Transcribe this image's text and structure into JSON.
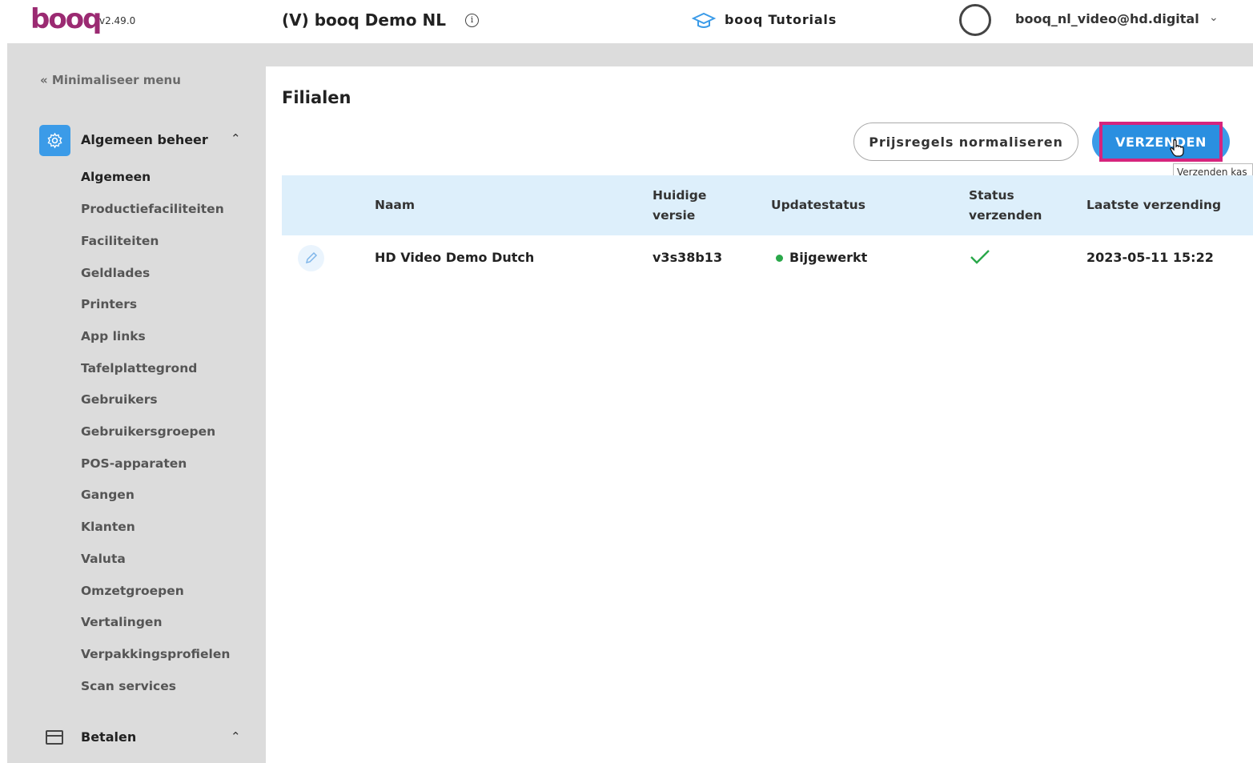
{
  "header": {
    "logo": "booq",
    "version": "v2.49.0",
    "venue": "(V) booq Demo NL",
    "tutorials": "booq Tutorials",
    "user_email": "booq_nl_video@hd.digital"
  },
  "sidebar": {
    "minimize_label": "Minimaliseer menu",
    "section_title": "Algemeen beheer",
    "items": [
      {
        "label": "Algemeen"
      },
      {
        "label": "Productiefaciliteiten"
      },
      {
        "label": "Faciliteiten"
      },
      {
        "label": "Geldlades"
      },
      {
        "label": "Printers"
      },
      {
        "label": "App links"
      },
      {
        "label": "Tafelplattegrond"
      },
      {
        "label": "Gebruikers"
      },
      {
        "label": "Gebruikersgroepen"
      },
      {
        "label": "POS-apparaten"
      },
      {
        "label": "Gangen"
      },
      {
        "label": "Klanten"
      },
      {
        "label": "Valuta"
      },
      {
        "label": "Omzetgroepen"
      },
      {
        "label": "Vertalingen"
      },
      {
        "label": "Verpakkingsprofielen"
      },
      {
        "label": "Scan services"
      }
    ],
    "next_section_title": "Betalen"
  },
  "main": {
    "title": "Filialen",
    "normalize_button": "Prijsregels normaliseren",
    "send_button": "VERZENDEN",
    "tooltip": "Verzenden kas",
    "columns": {
      "name": "Naam",
      "version_line1": "Huidige",
      "version_line2": "versie",
      "update_status": "Updatestatus",
      "send_status_line1": "Status",
      "send_status_line2": "verzenden",
      "last_sent": "Laatste verzending"
    },
    "rows": [
      {
        "name": "HD Video Demo Dutch",
        "version": "v3s38b13",
        "update_status": "Bijgewerkt",
        "last_sent": "2023-05-11 15:22"
      }
    ]
  },
  "colors": {
    "brand": "#9b2a72",
    "accent": "#3b9be8",
    "highlight": "#d6247d",
    "success": "#2aa84a"
  }
}
